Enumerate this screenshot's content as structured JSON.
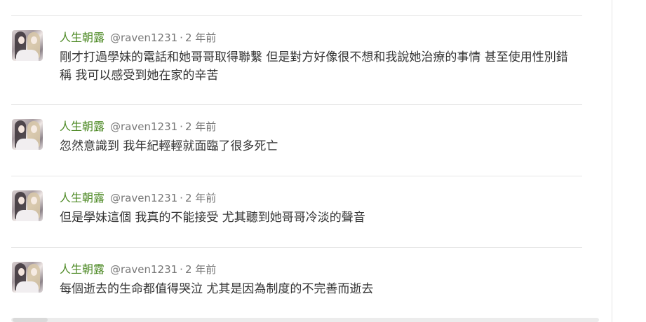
{
  "posts": [
    {
      "username": "人生朝露",
      "handle": "@raven1231",
      "separator": "·",
      "time": "2 年前",
      "text": "剛才打過學妹的電話和她哥哥取得聯繫 但是對方好像很不想和我說她治療的事情 甚至使用性別錯稱 我可以感受到她在家的辛苦",
      "avatar_icon": "user-avatar-icon"
    },
    {
      "username": "人生朝露",
      "handle": "@raven1231",
      "separator": "·",
      "time": "2 年前",
      "text": "忽然意識到 我年紀輕輕就面臨了很多死亡",
      "avatar_icon": "user-avatar-icon"
    },
    {
      "username": "人生朝露",
      "handle": "@raven1231",
      "separator": "·",
      "time": "2 年前",
      "text": "但是學妹這個 我真的不能接受 尤其聽到她哥哥冷淡的聲音",
      "avatar_icon": "user-avatar-icon"
    },
    {
      "username": "人生朝露",
      "handle": "@raven1231",
      "separator": "·",
      "time": "2 年前",
      "text": "每個逝去的生命都值得哭泣 尤其是因為制度的不完善而逝去",
      "avatar_icon": "user-avatar-icon"
    }
  ],
  "colors": {
    "username": "#4e8a26",
    "meta": "#777777",
    "text": "#333333",
    "divider": "#e6e6e6"
  }
}
